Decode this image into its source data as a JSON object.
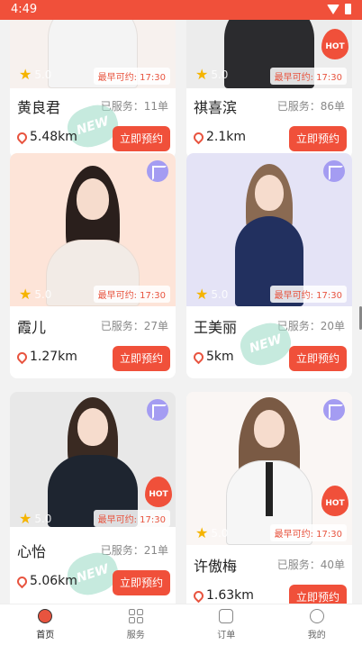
{
  "status": {
    "time": "4:49"
  },
  "cards": [
    {
      "name": "黄良君",
      "served": "已服务：11单",
      "distance": "5.48km",
      "rating": "5.0",
      "available": "最早可约: 17:30",
      "book": "立即预约",
      "new_label": "NEW"
    },
    {
      "name": "祺喜滨",
      "served": "已服务：86单",
      "distance": "2.1km",
      "rating": "5.0",
      "available": "最早可约: 17:30",
      "book": "立即预约",
      "hot_label": "HOT"
    },
    {
      "name": "霞儿",
      "served": "已服务：27单",
      "distance": "1.27km",
      "rating": "5.0",
      "available": "最早可约: 17:30",
      "book": "立即预约"
    },
    {
      "name": "王美丽",
      "served": "已服务：20单",
      "distance": "5km",
      "rating": "5.0",
      "available": "最早可约: 17:30",
      "book": "立即预约",
      "new_label": "NEW"
    },
    {
      "name": "心怡",
      "served": "已服务：21单",
      "distance": "5.06km",
      "rating": "5.0",
      "available": "最早可约: 17:30",
      "book": "立即预约",
      "hot_label": "HOT",
      "new_label": "NEW"
    },
    {
      "name": "许傲梅",
      "served": "已服务：40单",
      "distance": "1.63km",
      "rating": "5.0",
      "available": "最早可约: 17:30",
      "book": "立即预约",
      "hot_label": "HOT"
    }
  ],
  "tabs": [
    {
      "label": "首页"
    },
    {
      "label": "服务"
    },
    {
      "label": "订单"
    },
    {
      "label": "我的"
    }
  ],
  "colors": {
    "accent": "#f0503a",
    "expand": "#a49cf2",
    "star": "#f5b400"
  }
}
